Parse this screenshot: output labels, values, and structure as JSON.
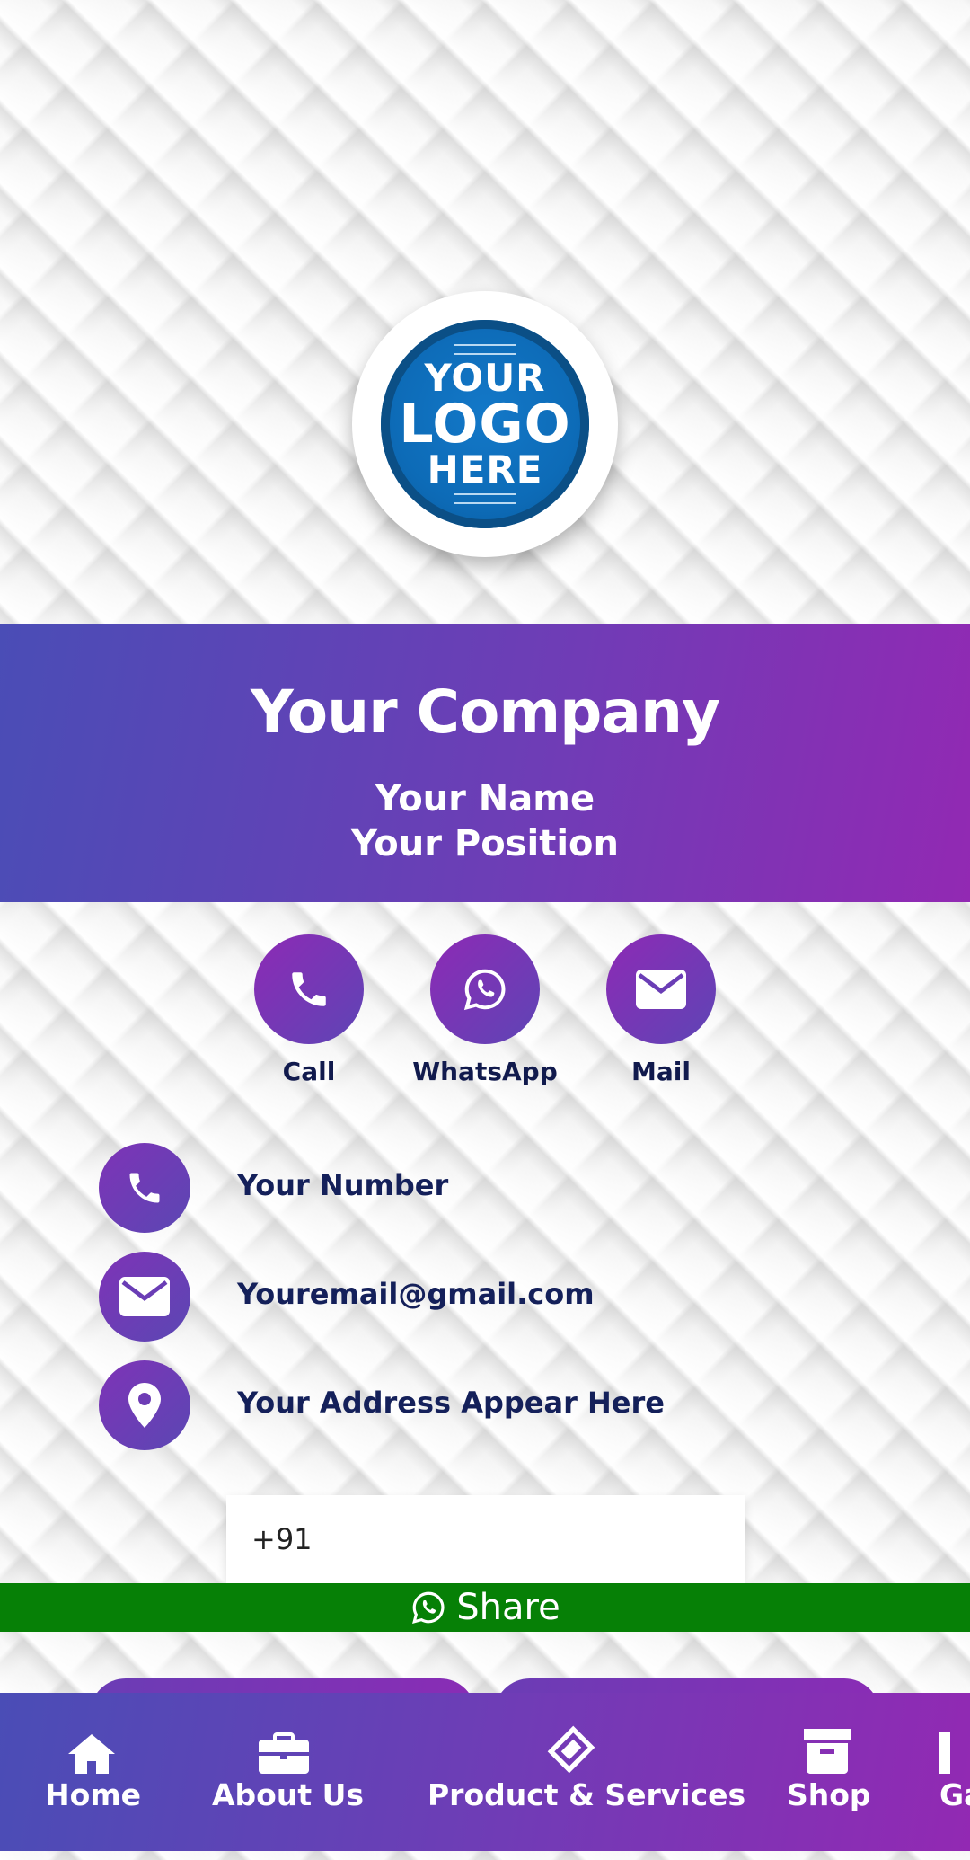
{
  "logo": {
    "line1": "YOUR",
    "line2": "LOGO",
    "line3": "HERE"
  },
  "banner": {
    "company": "Your Company",
    "name": "Your Name",
    "position": "Your Position"
  },
  "actions": [
    {
      "label": "Call",
      "icon": "phone-icon"
    },
    {
      "label": "WhatsApp",
      "icon": "whatsapp-icon"
    },
    {
      "label": "Mail",
      "icon": "mail-icon"
    }
  ],
  "contact": {
    "number": "Your Number",
    "email": "Youremail@gmail.com",
    "address": "Your Address Appear Here"
  },
  "share_form": {
    "phone_value": "+91",
    "share_label": "Share",
    "share_icon": "whatsapp-icon"
  },
  "nav": [
    {
      "label": "Home",
      "icon": "home-icon"
    },
    {
      "label": "About Us",
      "icon": "briefcase-icon"
    },
    {
      "label": "Product & Services",
      "icon": "tag-icon"
    },
    {
      "label": "Shop",
      "icon": "archive-box-icon"
    },
    {
      "label": "Ga"
    }
  ],
  "colors": {
    "accent_start": "#4a4db6",
    "accent_end": "#9229b3",
    "share_green": "#068006",
    "text_dark": "#14205a"
  }
}
